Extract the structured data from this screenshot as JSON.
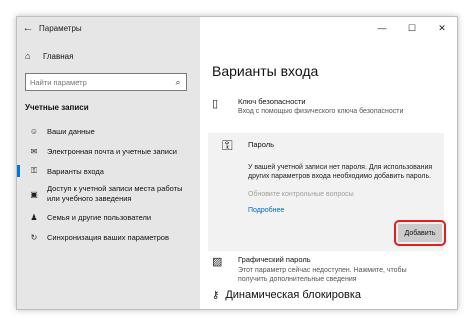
{
  "window": {
    "title": "Параметры",
    "back_icon": "←",
    "minimize": "—",
    "maximize": "☐",
    "close": "✕"
  },
  "sidebar": {
    "home_label": "Главная",
    "home_icon": "⌂",
    "search_placeholder": "Найти параметр",
    "search_icon": "⌕",
    "section_title": "Учетные записи",
    "items": [
      {
        "icon": "☺",
        "label": "Ваши данные"
      },
      {
        "icon": "✉",
        "label": "Электронная почта и учетные записи"
      },
      {
        "icon": "⚿",
        "label": "Варианты входа",
        "active": true
      },
      {
        "icon": "▣",
        "label": "Доступ к учетной записи места работы или учебного заведения"
      },
      {
        "icon": "♟",
        "label": "Семья и другие пользователи"
      },
      {
        "icon": "↻",
        "label": "Синхронизация ваших параметров"
      }
    ]
  },
  "main": {
    "title": "Варианты входа",
    "security_key": {
      "icon": "▯",
      "title": "Ключ безопасности",
      "subtitle": "Вход с помощью физического ключа безопасности"
    },
    "password": {
      "icon": "⚿",
      "title": "Пароль",
      "description": "У вашей учетной записи нет пароля. Для использования других параметров входа необходимо добавить пароль.",
      "disabled_link": "Обновите контрольные вопросы",
      "more_link": "Подробнее",
      "add_button": "Добавить"
    },
    "picture_password": {
      "icon": "▨",
      "title": "Графический пароль",
      "subtitle": "Этот параметр сейчас недоступен. Нажмите, чтобы получить дополнительные сведения"
    },
    "dynamic_lock": {
      "icon": "⚷",
      "title": "Динамическая блокировка"
    }
  },
  "colors": {
    "accent": "#0078d7",
    "highlight": "#e02020",
    "sidebar_bg": "#e6e6e6"
  }
}
